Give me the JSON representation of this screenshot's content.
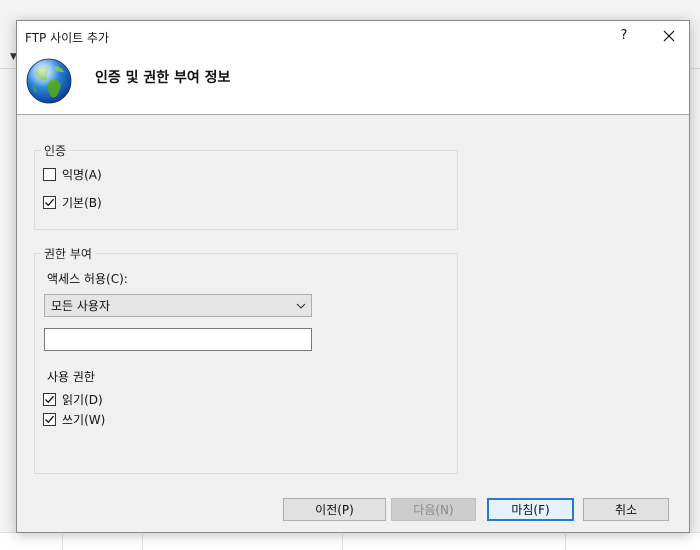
{
  "window": {
    "title": "FTP 사이트 추가",
    "help_label": "?"
  },
  "header": {
    "title": "인증 및 권한 부여 정보"
  },
  "authentication": {
    "group_title": "인증",
    "anonymous_label": "익명(A)",
    "anonymous_checked": false,
    "basic_label": "기본(B)",
    "basic_checked": true
  },
  "authorization": {
    "group_title": "권한 부여",
    "access_label": "액세스 허용(C):",
    "access_value": "모든 사용자",
    "access_text_value": "",
    "permissions_label": "사용 권한",
    "read_label": "읽기(D)",
    "read_checked": true,
    "write_label": "쓰기(W)",
    "write_checked": true
  },
  "buttons": {
    "previous": "이전(P)",
    "next": "다음(N)",
    "finish": "마침(F)",
    "cancel": "취소"
  },
  "icons": {
    "header_icon": "globe-icon",
    "close": "close-icon",
    "dropdown": "chevron-down-icon",
    "check": "checkmark-icon"
  },
  "colors": {
    "accent": "#2b78d4",
    "dialog_bg": "#f0f0f0",
    "header_bg": "#ffffff"
  }
}
